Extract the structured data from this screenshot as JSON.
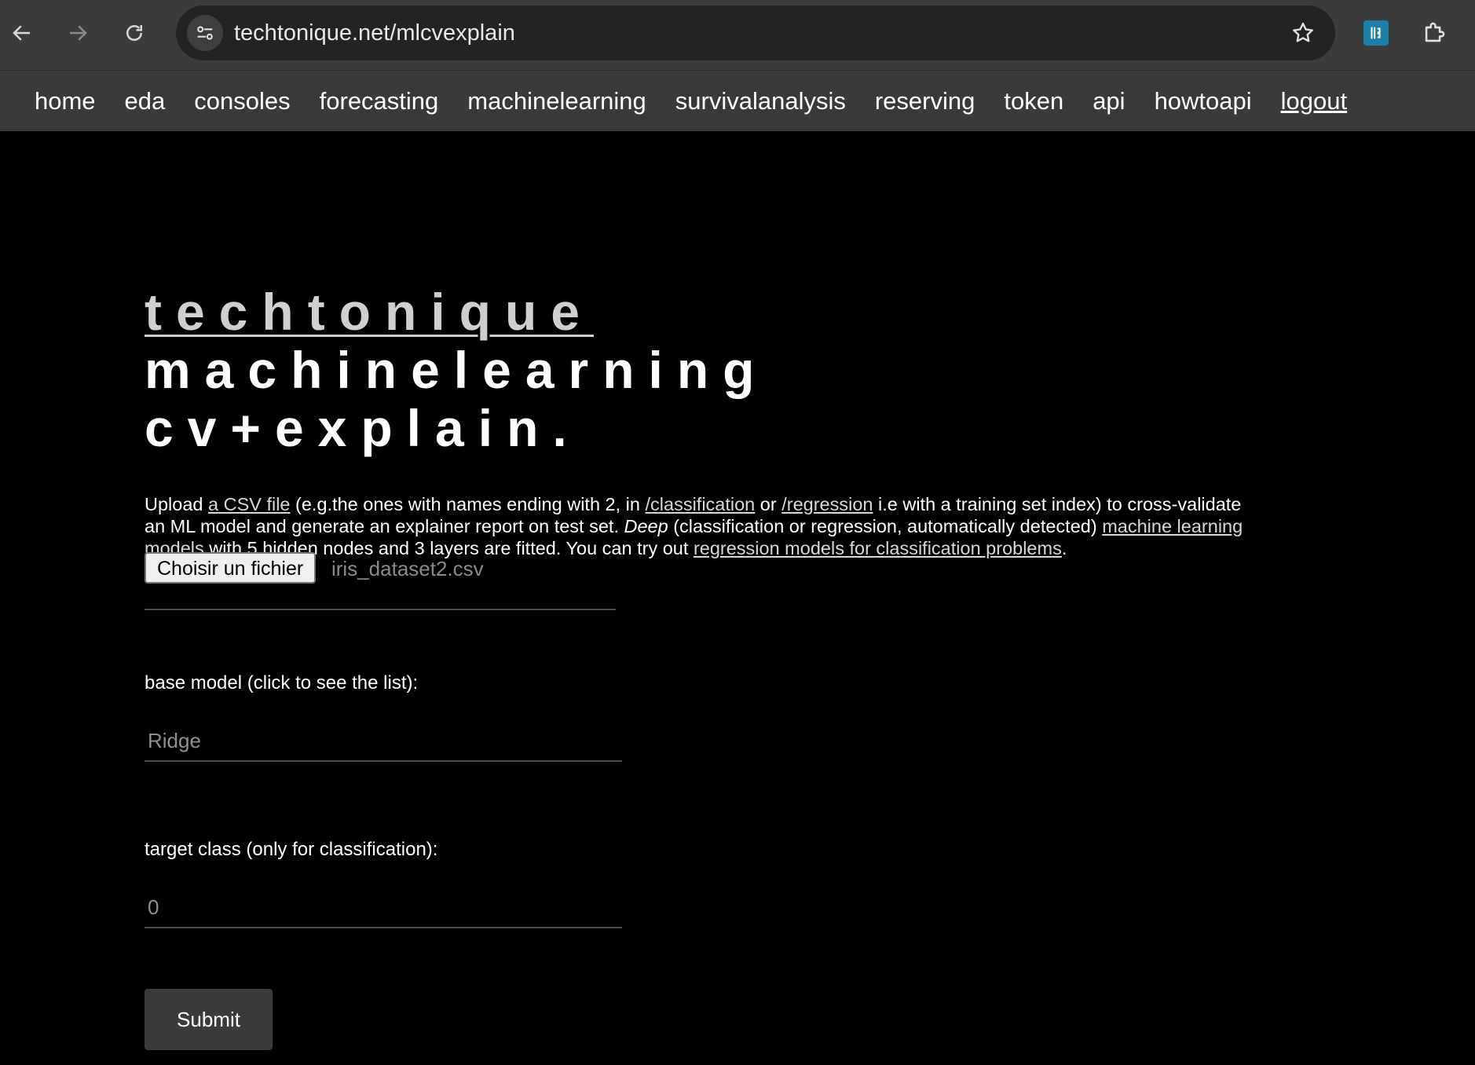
{
  "browser": {
    "url": "techtonique.net/mlcvexplain",
    "icons": {
      "back": "arrow-left-icon",
      "forward": "arrow-right-icon",
      "reload": "reload-icon",
      "site_info": "tune-icon",
      "bookmark": "star-icon",
      "extension": "extension-badge-icon",
      "extensions_menu": "puzzle-icon"
    }
  },
  "nav": {
    "items": [
      {
        "label": "home"
      },
      {
        "label": "eda"
      },
      {
        "label": "consoles"
      },
      {
        "label": "forecasting"
      },
      {
        "label": "machinelearning"
      },
      {
        "label": "survivalanalysis"
      },
      {
        "label": "reserving"
      },
      {
        "label": "token"
      },
      {
        "label": "api"
      },
      {
        "label": "howtoapi"
      },
      {
        "label": "logout"
      }
    ]
  },
  "title": {
    "brand": "techtonique",
    "rest_line1": "machinelearning",
    "line2": "cv+explain."
  },
  "intro": {
    "t1": "Upload ",
    "link_csv": "a CSV file",
    "t2": " (e.g.the ones with names ending with 2, in ",
    "link_classification": "/classification",
    "t3": " or ",
    "link_regression": "/regression",
    "t4": " i.e with a training set index) to cross-validate an ML model and generate an explainer report on test set. ",
    "deep": "Deep",
    "t5": " (classification or regression, automatically detected) ",
    "link_models": "machine learning models",
    "t6": " with 5 hidden nodes and 3 layers are fitted. You can try out ",
    "link_reg_for_class": "regression models for classification problems",
    "t7": "."
  },
  "form": {
    "file_button": "Choisir un fichier",
    "file_name": "iris_dataset2.csv",
    "base_model_label": "base model (click to see the list):",
    "base_model_placeholder": "Ridge",
    "target_label": "target class (only for classification):",
    "target_placeholder": "0",
    "submit": "Submit"
  },
  "colors": {
    "background": "#000000",
    "nav_bar": "#3a3a3a",
    "chrome": "#3c3c3c",
    "omnibox": "#232323",
    "submit_bg": "#3b3b3b",
    "field_underline": "#4a4a4a"
  }
}
